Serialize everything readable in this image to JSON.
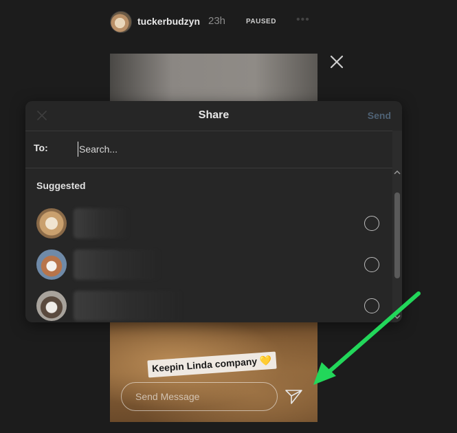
{
  "story": {
    "username": "tuckerbudzyn",
    "time": "23h",
    "status": "PAUSED",
    "more_icon": "ellipsis-icon",
    "sticker_text": "Keepin Linda company",
    "sticker_emoji": "💛",
    "send_message_placeholder": "Send Message",
    "send_icon": "paper-plane-icon",
    "close_icon": "close-icon"
  },
  "share_modal": {
    "title": "Share",
    "send_label": "Send",
    "close_icon": "close-icon",
    "to_label": "To:",
    "search_placeholder": "Search...",
    "suggested_label": "Suggested",
    "contacts": [
      {
        "avatar": "dog-avatar-1",
        "selected": false
      },
      {
        "avatar": "dog-avatar-2",
        "selected": false
      },
      {
        "avatar": "dog-avatar-3",
        "selected": false
      }
    ]
  },
  "annotation": {
    "arrow_color": "#22d75a"
  },
  "colors": {
    "modal_bg": "#262626",
    "send_disabled": "#4f6275",
    "page_bg": "#1c1c1c"
  }
}
